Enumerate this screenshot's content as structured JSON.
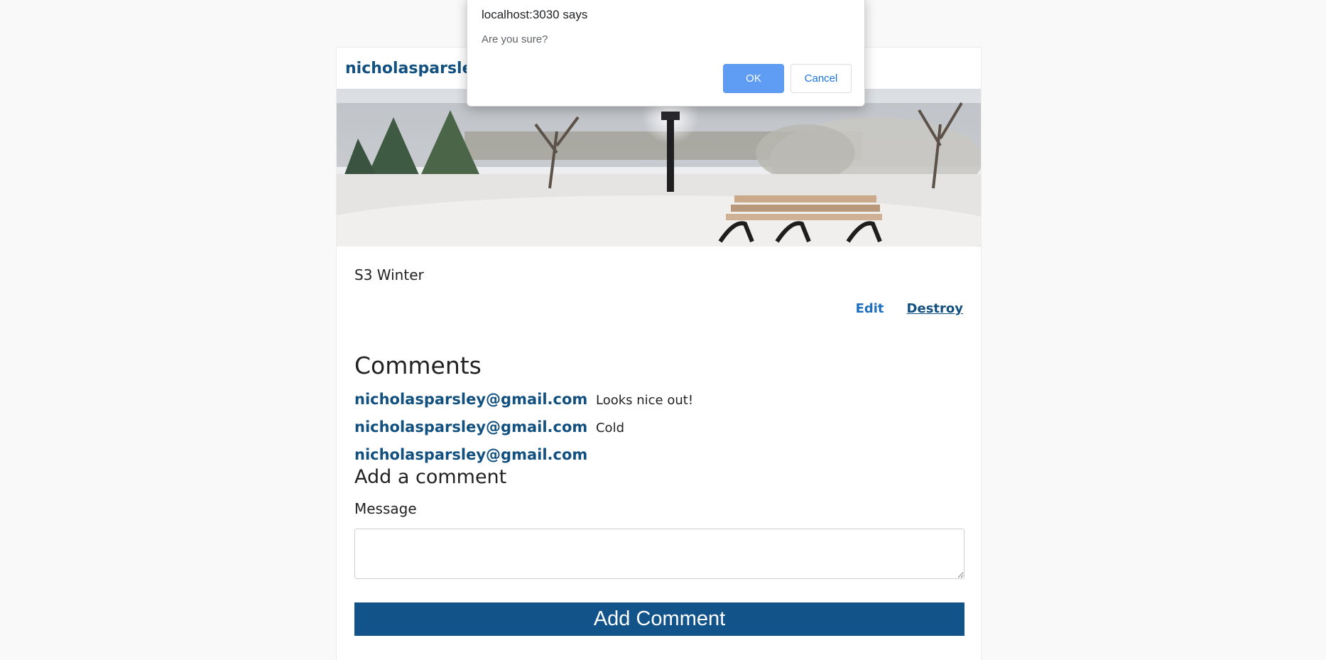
{
  "post": {
    "author": "nicholasparsley@gmail.com",
    "caption": "S3 Winter",
    "actions": {
      "edit": "Edit",
      "destroy": "Destroy"
    }
  },
  "comments": {
    "heading": "Comments",
    "items": [
      {
        "author": "nicholasparsley@gmail.com",
        "text": "Looks nice out!"
      },
      {
        "author": "nicholasparsley@gmail.com",
        "text": "Cold"
      },
      {
        "author": "nicholasparsley@gmail.com",
        "text": ""
      }
    ]
  },
  "add_comment": {
    "heading": "Add a comment",
    "label": "Message",
    "value": "",
    "submit": "Add Comment"
  },
  "dialog": {
    "title": "localhost:3030 says",
    "message": "Are you sure?",
    "ok": "OK",
    "cancel": "Cancel",
    "ok_color": "#5f9df5",
    "cancel_text_color": "#1a73e8"
  },
  "colors": {
    "brand": "#12507f",
    "button": "#12548a",
    "background": "#f9f9f9"
  }
}
